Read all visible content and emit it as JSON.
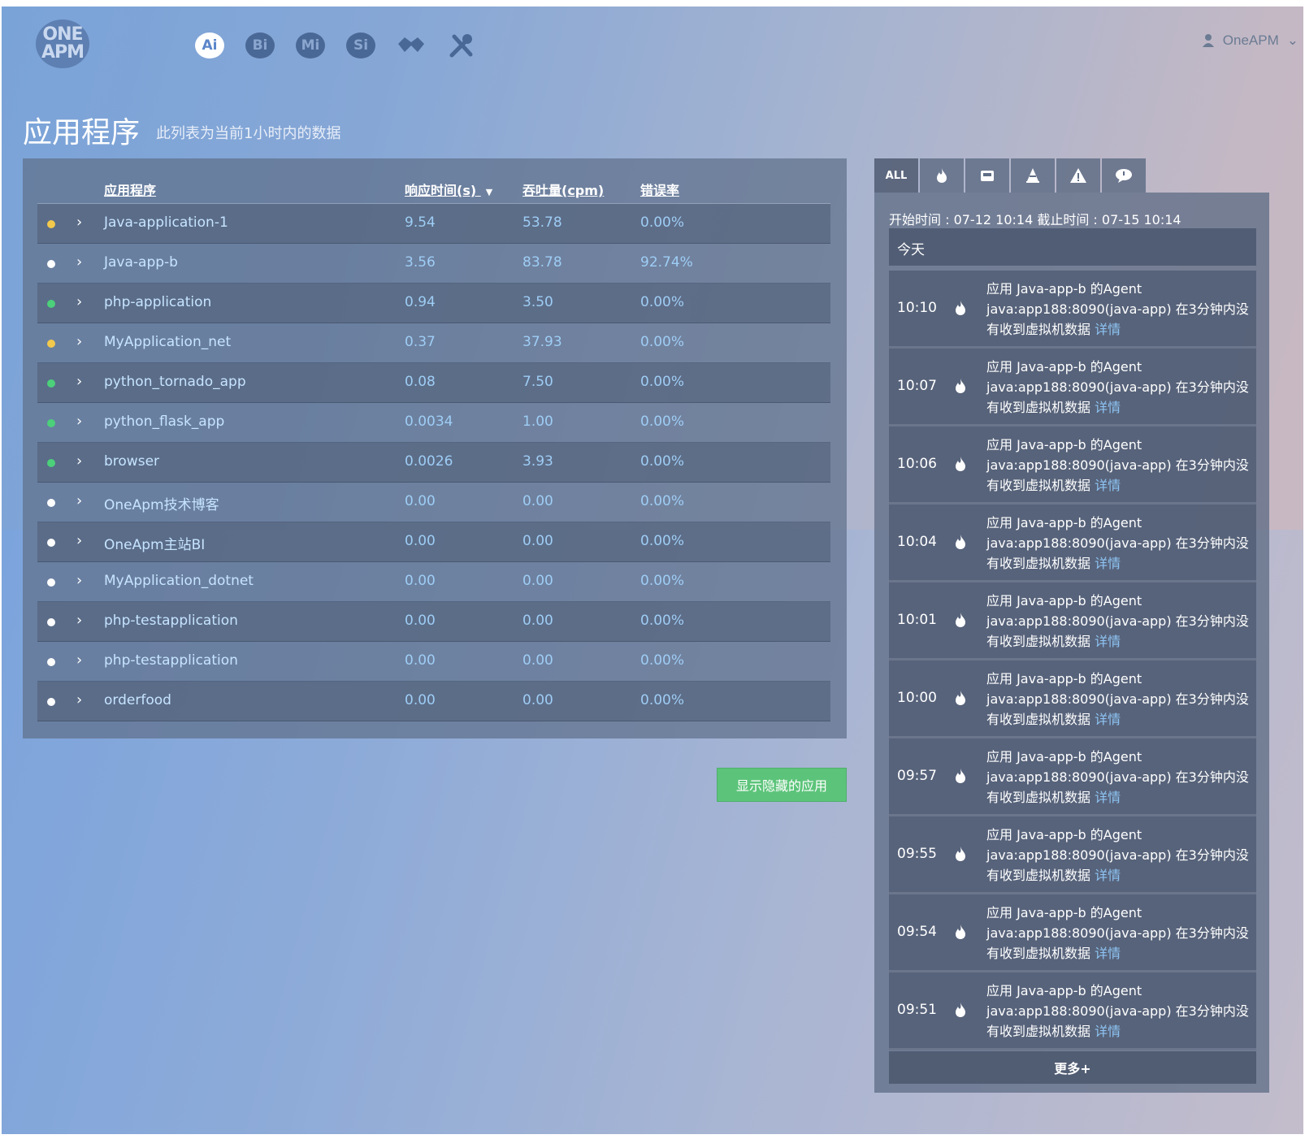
{
  "brand": {
    "logo_line1": "ONE",
    "logo_line2": "APM"
  },
  "nav": [
    {
      "label": "Ai",
      "icon": "ai-icon",
      "active": true
    },
    {
      "label": "Bi",
      "icon": "bi-icon",
      "active": false
    },
    {
      "label": "Mi",
      "icon": "mi-icon",
      "active": false
    },
    {
      "label": "Si",
      "icon": "si-icon",
      "active": false
    },
    {
      "label": "",
      "icon": "handshake-icon",
      "active": false
    },
    {
      "label": "",
      "icon": "tools-icon",
      "active": false
    }
  ],
  "user": {
    "name": "OneAPM"
  },
  "page": {
    "title": "应用程序",
    "subtitle": "此列表为当前1小时内的数据"
  },
  "table": {
    "headers": {
      "name": "应用程序",
      "response": "响应时间(s)",
      "throughput": "吞吐量(cpm)",
      "error": "错误率"
    },
    "rows": [
      {
        "status": "yellow",
        "name": "Java-application-1",
        "response": "9.54",
        "throughput": "53.78",
        "error": "0.00%"
      },
      {
        "status": "white",
        "name": "Java-app-b",
        "response": "3.56",
        "throughput": "83.78",
        "error": "92.74%"
      },
      {
        "status": "green",
        "name": "php-application",
        "response": "0.94",
        "throughput": "3.50",
        "error": "0.00%"
      },
      {
        "status": "yellow",
        "name": "MyApplication_net",
        "response": "0.37",
        "throughput": "37.93",
        "error": "0.00%"
      },
      {
        "status": "green",
        "name": "python_tornado_app",
        "response": "0.08",
        "throughput": "7.50",
        "error": "0.00%"
      },
      {
        "status": "green",
        "name": "python_flask_app",
        "response": "0.0034",
        "throughput": "1.00",
        "error": "0.00%"
      },
      {
        "status": "green",
        "name": "browser",
        "response": "0.0026",
        "throughput": "3.93",
        "error": "0.00%"
      },
      {
        "status": "white",
        "name": "OneApm技术博客",
        "response": "0.00",
        "throughput": "0.00",
        "error": "0.00%"
      },
      {
        "status": "white",
        "name": "OneApm主站BI",
        "response": "0.00",
        "throughput": "0.00",
        "error": "0.00%"
      },
      {
        "status": "white",
        "name": "MyApplication_dotnet",
        "response": "0.00",
        "throughput": "0.00",
        "error": "0.00%"
      },
      {
        "status": "white",
        "name": "php-testapplication",
        "response": "0.00",
        "throughput": "0.00",
        "error": "0.00%"
      },
      {
        "status": "white",
        "name": "php-testapplication",
        "response": "0.00",
        "throughput": "0.00",
        "error": "0.00%"
      },
      {
        "status": "white",
        "name": "orderfood",
        "response": "0.00",
        "throughput": "0.00",
        "error": "0.00%"
      }
    ]
  },
  "buttons": {
    "show_hidden": "显示隐藏的应用"
  },
  "events": {
    "tabs": [
      {
        "label": "ALL",
        "icon": "all-icon"
      },
      {
        "label": "",
        "icon": "fire-icon"
      },
      {
        "label": "",
        "icon": "inbox-icon"
      },
      {
        "label": "",
        "icon": "cone-icon"
      },
      {
        "label": "",
        "icon": "warning-icon"
      },
      {
        "label": "",
        "icon": "comment-icon"
      }
    ],
    "range": "开始时间 : 07-12 10:14 截止时间 : 07-15 10:14",
    "today": "今天",
    "link_label": "详情",
    "items": [
      {
        "time": "10:10",
        "text": "应用 Java-app-b 的Agent java:app188:8090(java-app) 在3分钟内没有收到虚拟机数据"
      },
      {
        "time": "10:07",
        "text": "应用 Java-app-b 的Agent java:app188:8090(java-app) 在3分钟内没有收到虚拟机数据"
      },
      {
        "time": "10:06",
        "text": "应用 Java-app-b 的Agent java:app188:8090(java-app) 在3分钟内没有收到虚拟机数据"
      },
      {
        "time": "10:04",
        "text": "应用 Java-app-b 的Agent java:app188:8090(java-app) 在3分钟内没有收到虚拟机数据"
      },
      {
        "time": "10:01",
        "text": "应用 Java-app-b 的Agent java:app188:8090(java-app) 在3分钟内没有收到虚拟机数据"
      },
      {
        "time": "10:00",
        "text": "应用 Java-app-b 的Agent java:app188:8090(java-app) 在3分钟内没有收到虚拟机数据"
      },
      {
        "time": "09:57",
        "text": "应用 Java-app-b 的Agent java:app188:8090(java-app) 在3分钟内没有收到虚拟机数据"
      },
      {
        "time": "09:55",
        "text": "应用 Java-app-b 的Agent java:app188:8090(java-app) 在3分钟内没有收到虚拟机数据"
      },
      {
        "time": "09:54",
        "text": "应用 Java-app-b 的Agent java:app188:8090(java-app) 在3分钟内没有收到虚拟机数据"
      },
      {
        "time": "09:51",
        "text": "应用 Java-app-b 的Agent java:app188:8090(java-app) 在3分钟内没有收到虚拟机数据"
      }
    ],
    "more": "更多+"
  },
  "colors": {
    "yellow": "#f2c94c",
    "green": "#4cd07a",
    "white": "#ffffff",
    "link": "#8ec4f3",
    "button": "#5cc47a"
  }
}
